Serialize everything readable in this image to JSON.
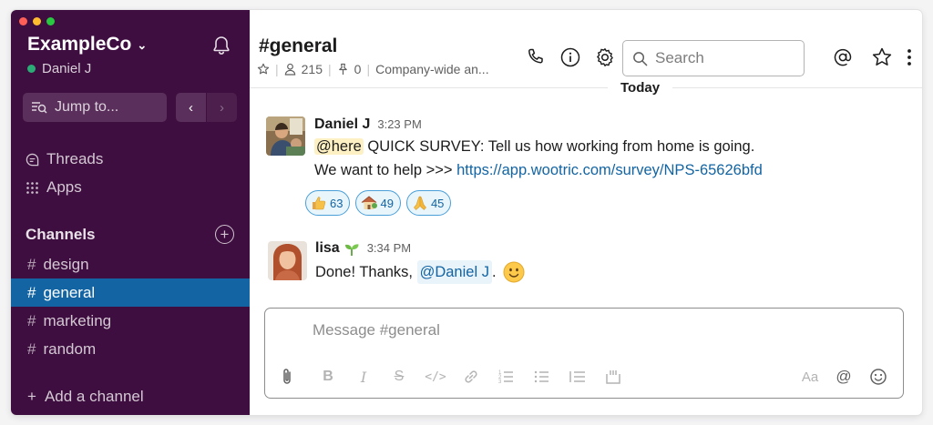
{
  "colors": {
    "sidebar": "#3f0e40",
    "active_channel": "#1264a3",
    "presence": "#2bac76",
    "link": "#1264a3"
  },
  "workspace": {
    "name": "ExampleCo",
    "user": "Daniel J"
  },
  "sidebar": {
    "jump_label": "Jump to...",
    "threads_label": "Threads",
    "apps_label": "Apps",
    "channels_header": "Channels",
    "channels": [
      {
        "name": "design",
        "active": false
      },
      {
        "name": "general",
        "active": true
      },
      {
        "name": "marketing",
        "active": false
      },
      {
        "name": "random",
        "active": false
      }
    ],
    "add_channel_label": "Add a channel"
  },
  "channel": {
    "title": "#general",
    "members": "215",
    "pins": "0",
    "topic": "Company-wide an..."
  },
  "search": {
    "placeholder": "Search"
  },
  "day_divider": "Today",
  "messages": [
    {
      "author": "Daniel J",
      "time": "3:23 PM",
      "mention": "@here",
      "line1": "QUICK SURVEY: Tell us how working from home is going.",
      "line2_prefix": "We want to help >>> ",
      "link": "https://app.wootric.com/survey/NPS-65626bfd",
      "reactions": [
        {
          "icon": "thumbs-up-emoji",
          "count": "63"
        },
        {
          "icon": "house-emoji",
          "count": "49"
        },
        {
          "icon": "folded-hands-emoji",
          "count": "45"
        }
      ]
    },
    {
      "author": "lisa",
      "author_emoji": "seedling-emoji",
      "time": "3:34 PM",
      "text_prefix": "Done! Thanks, ",
      "mention": "@Daniel J",
      "text_suffix": "."
    }
  ],
  "composer": {
    "placeholder": "Message #general",
    "toolbar": [
      "attach-icon",
      "bold-icon",
      "italic-icon",
      "strikethrough-icon",
      "code-icon",
      "link-icon",
      "ordered-list-icon",
      "bullet-list-icon",
      "blockquote-icon",
      "code-block-icon",
      "format-toggle-icon",
      "mention-icon",
      "emoji-icon"
    ],
    "format_label": "Aa",
    "mention_symbol": "@"
  }
}
